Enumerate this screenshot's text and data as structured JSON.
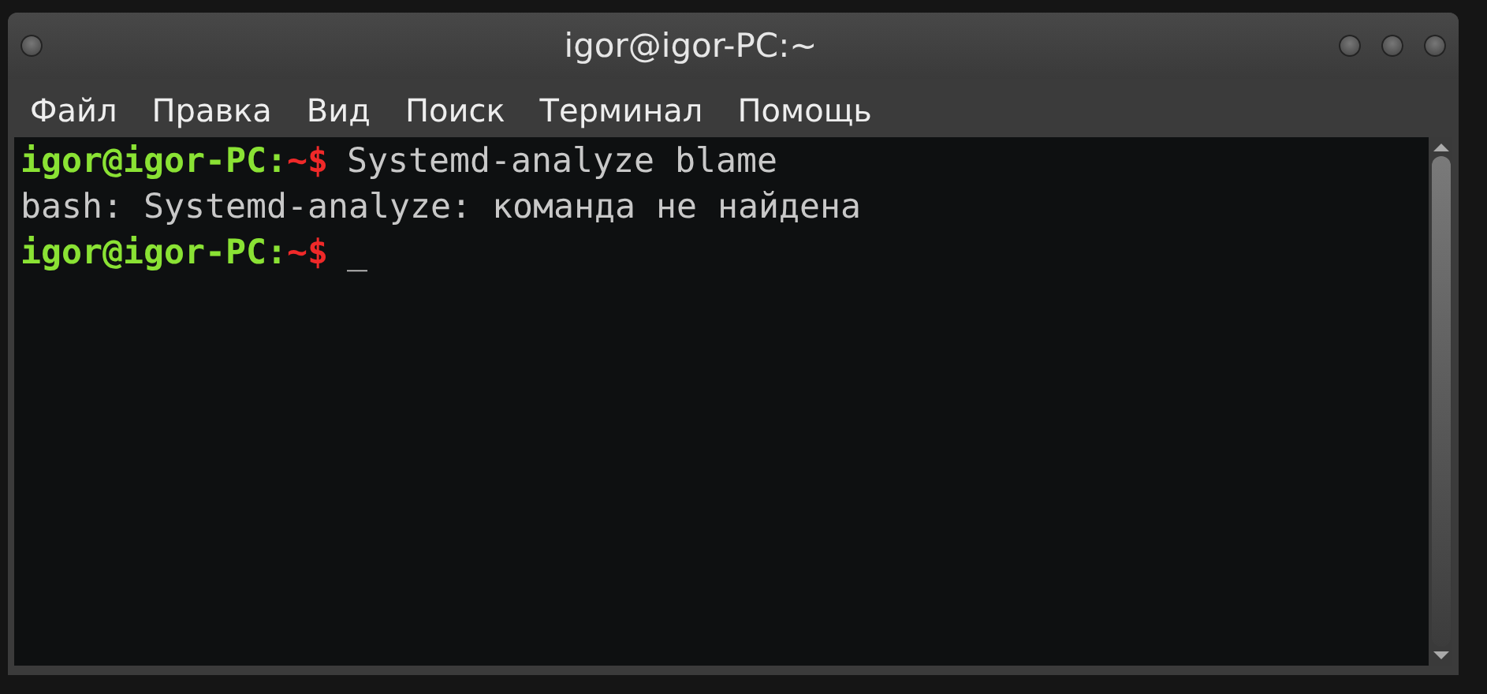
{
  "window": {
    "title": "igor@igor-PC:~"
  },
  "menu": [
    "Файл",
    "Правка",
    "Вид",
    "Поиск",
    "Терминал",
    "Помощь"
  ],
  "terminal": {
    "lines": [
      {
        "kind": "prompt",
        "user": "igor@igor-PC:",
        "path": "~$",
        "command": "Systemd-analyze blame"
      },
      {
        "kind": "output",
        "text": "bash: Systemd-analyze: команда не найдена"
      },
      {
        "kind": "prompt",
        "user": "igor@igor-PC:",
        "path": "~$",
        "cursor": "_"
      }
    ]
  }
}
